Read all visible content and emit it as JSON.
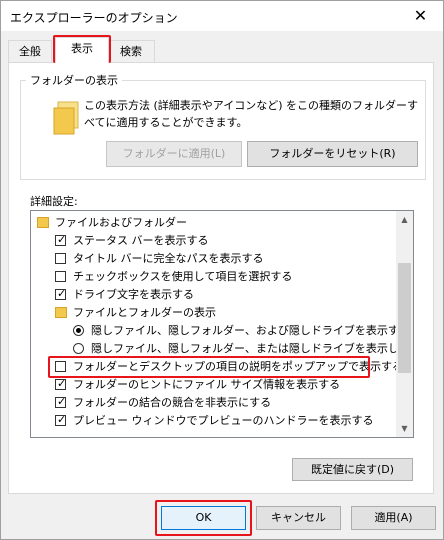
{
  "window": {
    "title": "エクスプローラーのオプション",
    "close_glyph": "✕"
  },
  "tabs": [
    {
      "label": "全般"
    },
    {
      "label": "表示"
    },
    {
      "label": "検索"
    }
  ],
  "folder_views": {
    "legend": "フォルダーの表示",
    "description": "この表示方法 (詳細表示やアイコンなど) をこの種類のフォルダーすべてに適用することができます。",
    "apply_button": "フォルダーに適用(L)",
    "reset_button": "フォルダーをリセット(R)"
  },
  "advanced": {
    "label": "詳細設定:",
    "items": [
      {
        "type": "folder",
        "label": "ファイルおよびフォルダー"
      },
      {
        "type": "check",
        "checked": true,
        "label": "ステータス バーを表示する"
      },
      {
        "type": "check",
        "checked": false,
        "label": "タイトル バーに完全なパスを表示する"
      },
      {
        "type": "check",
        "checked": false,
        "label": "チェックボックスを使用して項目を選択する"
      },
      {
        "type": "check",
        "checked": true,
        "label": "ドライブ文字を表示する"
      },
      {
        "type": "folder",
        "label": "ファイルとフォルダーの表示"
      },
      {
        "type": "radio",
        "checked": true,
        "label": "隠しファイル、隠しフォルダー、および隠しドライブを表示する"
      },
      {
        "type": "radio",
        "checked": false,
        "label": "隠しファイル、隠しフォルダー、または隠しドライブを表示しない"
      },
      {
        "type": "check",
        "checked": false,
        "label": "フォルダーとデスクトップの項目の説明をポップアップで表示する"
      },
      {
        "type": "check",
        "checked": true,
        "label": "フォルダーのヒントにファイル サイズ情報を表示する"
      },
      {
        "type": "check",
        "checked": true,
        "label": "フォルダーの結合の競合を非表示にする"
      },
      {
        "type": "check",
        "checked": true,
        "label": "プレビュー ウィンドウでプレビューのハンドラーを表示する"
      }
    ],
    "restore_defaults": "既定値に戻す(D)"
  },
  "footer": {
    "ok": "OK",
    "cancel": "キャンセル",
    "apply": "適用(A)"
  },
  "colors": {
    "highlight": "#e8141b",
    "focus": "#0078d7"
  }
}
